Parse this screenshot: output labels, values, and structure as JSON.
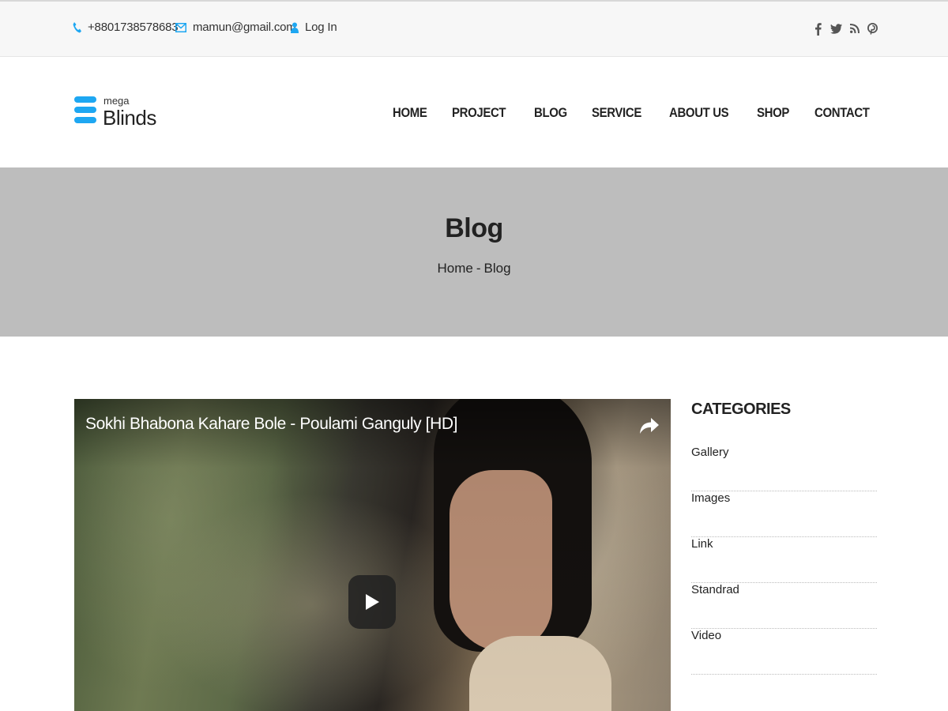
{
  "topbar": {
    "phone": "+8801738578683",
    "email": "mamun@gmail.com",
    "login": "Log In",
    "social_icons": [
      "facebook-icon",
      "twitter-icon",
      "rss-icon",
      "pinterest-icon"
    ],
    "accent_color": "#1ea7f2"
  },
  "logo": {
    "small": "mega",
    "big": "Blinds"
  },
  "nav": {
    "items": [
      "HOME",
      "PROJECT",
      "BLOG",
      "SERVICE",
      "ABOUT US",
      "SHOP",
      "CONTACT"
    ]
  },
  "banner": {
    "title": "Blog",
    "breadcrumb": {
      "home": "Home",
      "separator": "-",
      "current": "Blog"
    },
    "background_color": "#bdbdbd"
  },
  "video": {
    "title": "Sokhi Bhabona Kahare Bole - Poulami Ganguly [HD]"
  },
  "sidebar": {
    "heading": "CATEGORIES",
    "categories": [
      "Gallery",
      "Images",
      "Link",
      "Standrad",
      "Video"
    ]
  }
}
